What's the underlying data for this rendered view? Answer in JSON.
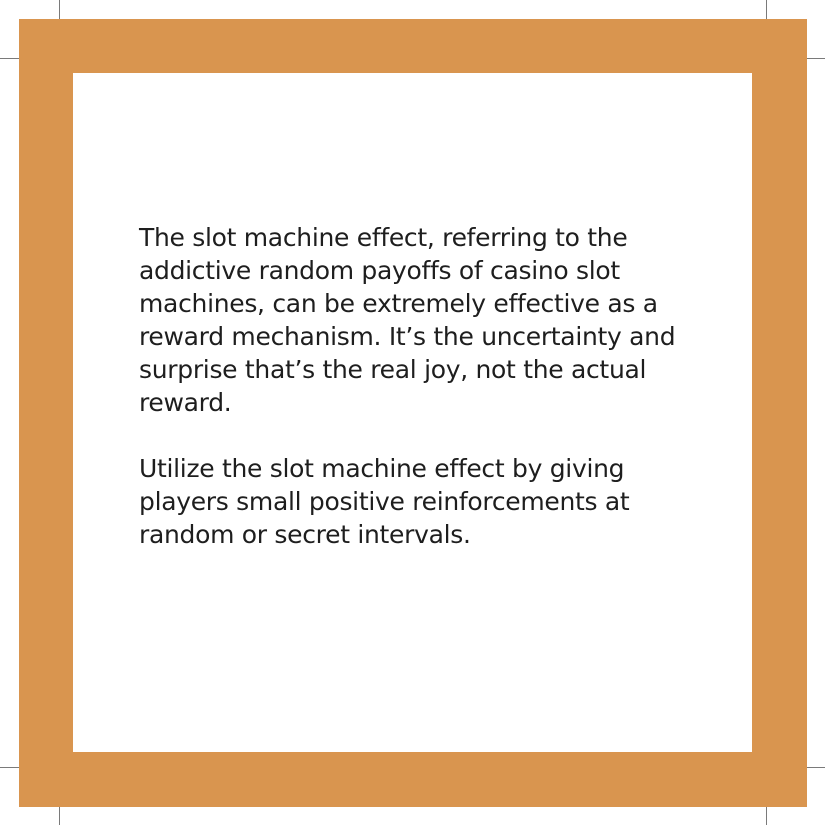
{
  "card": {
    "paragraphs": [
      "The slot machine effect, referring to the addictive random payoffs of casino slot machines, can be extremely effective as a reward mechanism. It’s the uncertainty and surprise that’s the real joy, not the actual reward.",
      "Utilize the slot machine effect by giving players small positive reinforcements at random or secret intervals."
    ],
    "colors": {
      "border": "#d9954f",
      "background": "#ffffff",
      "text": "#1e1e1e",
      "crop_marks": "#7a7a7a"
    }
  }
}
